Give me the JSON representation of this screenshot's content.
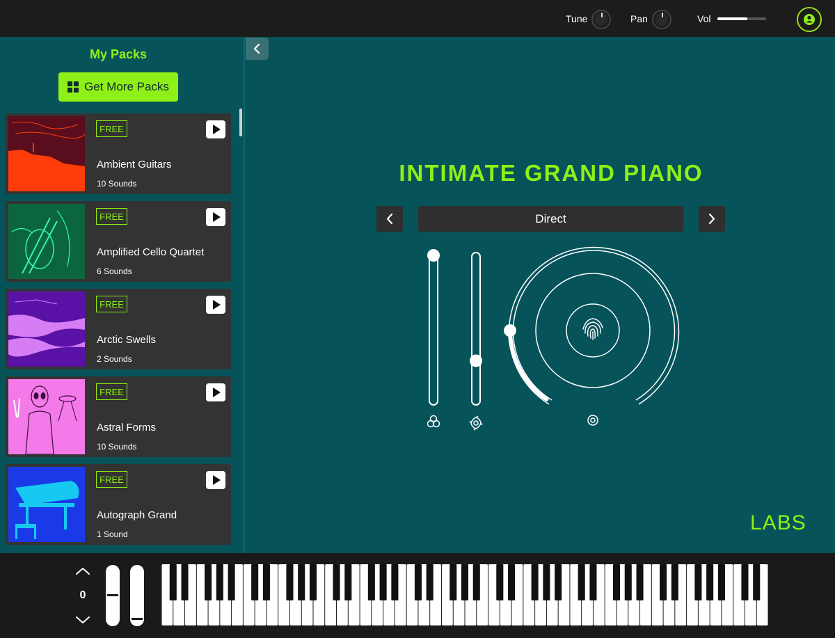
{
  "topbar": {
    "tune_label": "Tune",
    "pan_label": "Pan",
    "vol_label": "Vol",
    "vol_level": 0.62,
    "user_icon": "user-icon"
  },
  "sidebar": {
    "title": "My Packs",
    "more_button_label": "Get More Packs",
    "packs": [
      {
        "badge": "FREE",
        "name": "Ambient Guitars",
        "count": "10 Sounds",
        "art_color": "#ff3d0a"
      },
      {
        "badge": "FREE",
        "name": "Amplified Cello Quartet",
        "count": "6 Sounds",
        "art_color": "#0b6640"
      },
      {
        "badge": "FREE",
        "name": "Arctic Swells",
        "count": "2 Sounds",
        "art_color": "#5a12a6"
      },
      {
        "badge": "FREE",
        "name": "Astral Forms",
        "count": "10 Sounds",
        "art_color": "#f47ae9"
      },
      {
        "badge": "FREE",
        "name": "Autograph Grand",
        "count": "1 Sound",
        "art_color": "#17c9f0"
      }
    ]
  },
  "instrument": {
    "title": "INTIMATE GRAND PIANO",
    "preset": "Direct",
    "slider_1_level": 1.0,
    "slider_2_level": 0.27,
    "arc_level": 0.25
  },
  "brand": {
    "logo": "LABS"
  },
  "keyboard": {
    "octave": "0"
  },
  "colors": {
    "accent": "#8ef016",
    "panel_bg": "#07535a",
    "card_bg": "#333333"
  }
}
